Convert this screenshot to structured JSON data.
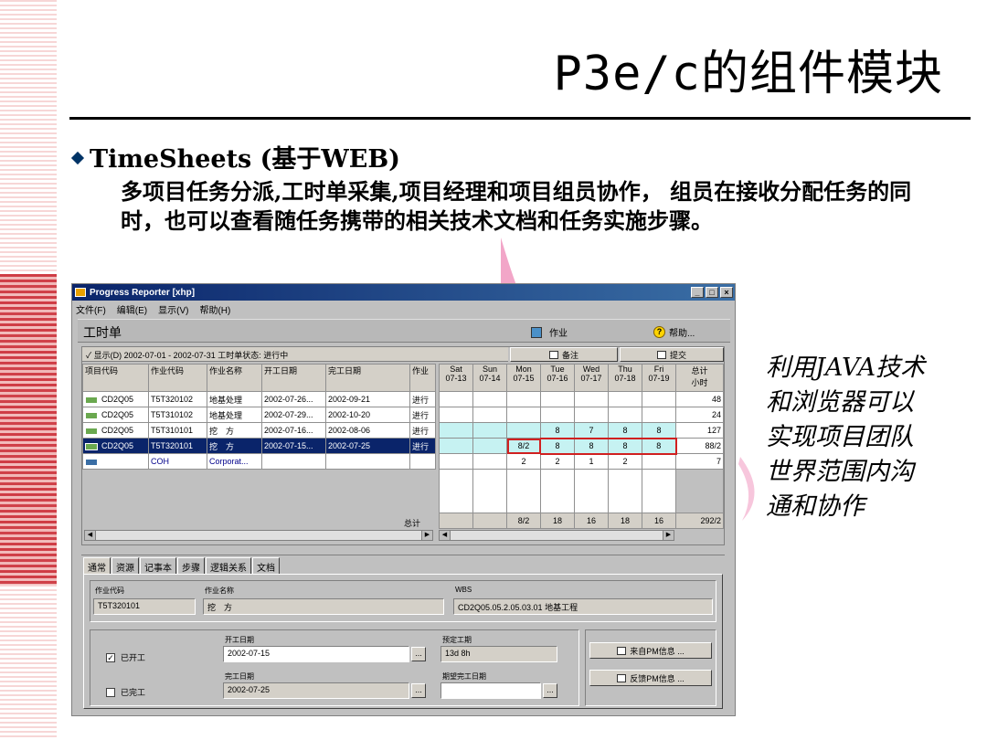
{
  "slide": {
    "title": "P3e/c的组件模块",
    "bullet_heading": "TimeSheets (基于WEB)",
    "bullet_body": "多项目任务分派,工时单采集,项目经理和项目组员协作， 组员在接收分配任务的同时，也可以查看随任务携带的相关技术文档和任务实施步骤。",
    "side_note": "利用JAVA技术和浏览器可以实现项目团队世界范围内沟通和协作"
  },
  "window": {
    "title": "Progress Reporter [xhp]",
    "controls": [
      "_",
      "□",
      "×"
    ],
    "menu": [
      "文件(F)",
      "编辑(E)",
      "显示(V)",
      "帮助(H)"
    ],
    "toolbar": {
      "title": "工时单",
      "activity": "作业",
      "help": "帮助..."
    },
    "period_bar": "✓ 显示(D) 2002-07-01 - 2002-07-31   工时单状态: 进行中",
    "note_button": "备注",
    "submit_button": "提交",
    "left_columns": [
      "项目代码",
      "作业代码",
      "作业名称",
      "开工日期",
      "完工日期",
      "作业"
    ],
    "rows": [
      {
        "project": "CD2Q05",
        "code": "T5T320102",
        "name": "地基处理",
        "start": "2002-07-26...",
        "finish": "2002-09-21",
        "status": "进行"
      },
      {
        "project": "CD2Q05",
        "code": "T5T310102",
        "name": "地基处理",
        "start": "2002-07-29...",
        "finish": "2002-10-20",
        "status": "进行"
      },
      {
        "project": "CD2Q05",
        "code": "T5T310101",
        "name": "挖　方",
        "start": "2002-07-16...",
        "finish": "2002-08-06",
        "status": "进行"
      },
      {
        "project": "CD2Q05",
        "code": "T5T320101",
        "name": "挖　方",
        "start": "2002-07-15...",
        "finish": "2002-07-25",
        "status": "进行"
      },
      {
        "project": "",
        "code": "COH",
        "name": "Corporat...",
        "start": "",
        "finish": "",
        "status": ""
      }
    ],
    "total_label": "总计",
    "day_columns": [
      {
        "day": "Sat",
        "date": "07-13"
      },
      {
        "day": "Sun",
        "date": "07-14"
      },
      {
        "day": "Mon",
        "date": "07-15"
      },
      {
        "day": "Tue",
        "date": "07-16"
      },
      {
        "day": "Wed",
        "date": "07-17"
      },
      {
        "day": "Thu",
        "date": "07-18"
      },
      {
        "day": "Fri",
        "date": "07-19"
      }
    ],
    "total_col": {
      "line1": "总计",
      "line2": "小时"
    },
    "hours": [
      [
        "",
        "",
        "",
        "",
        "",
        "",
        "",
        "48"
      ],
      [
        "",
        "",
        "",
        "",
        "",
        "",
        "",
        "24"
      ],
      [
        "",
        "",
        "",
        "8",
        "7",
        "8",
        "8",
        "127"
      ],
      [
        "",
        "",
        "8/2",
        "8",
        "8",
        "8",
        "8",
        "88/2"
      ],
      [
        "",
        "",
        "2",
        "2",
        "1",
        "2",
        "",
        "7"
      ]
    ],
    "totals": [
      "",
      "",
      "8/2",
      "18",
      "16",
      "18",
      "16",
      "292/2"
    ],
    "tabs": [
      "通常",
      "资源",
      "记事本",
      "步骤",
      "逻辑关系",
      "文档"
    ],
    "details": {
      "code_label": "作业代码",
      "code_value": "T5T320101",
      "name_label": "作业名称",
      "name_value": "挖　方",
      "wbs_label": "WBS",
      "wbs_value": "CD2Q05.05.2.05.03.01 地基工程",
      "started_label": "已开工",
      "finished_label": "已完工",
      "start_label": "开工日期",
      "start_value": "2002-07-15",
      "finish_label": "完工日期",
      "finish_value": "2002-07-25",
      "remaining_label": "预定工期",
      "remaining_value": "13d 8h",
      "expected_label": "期望完工日期",
      "expected_value": "",
      "from_pm_button": "来自PM信息 ...",
      "to_pm_button": "反馈PM信息 ...",
      "dots": "..."
    }
  }
}
